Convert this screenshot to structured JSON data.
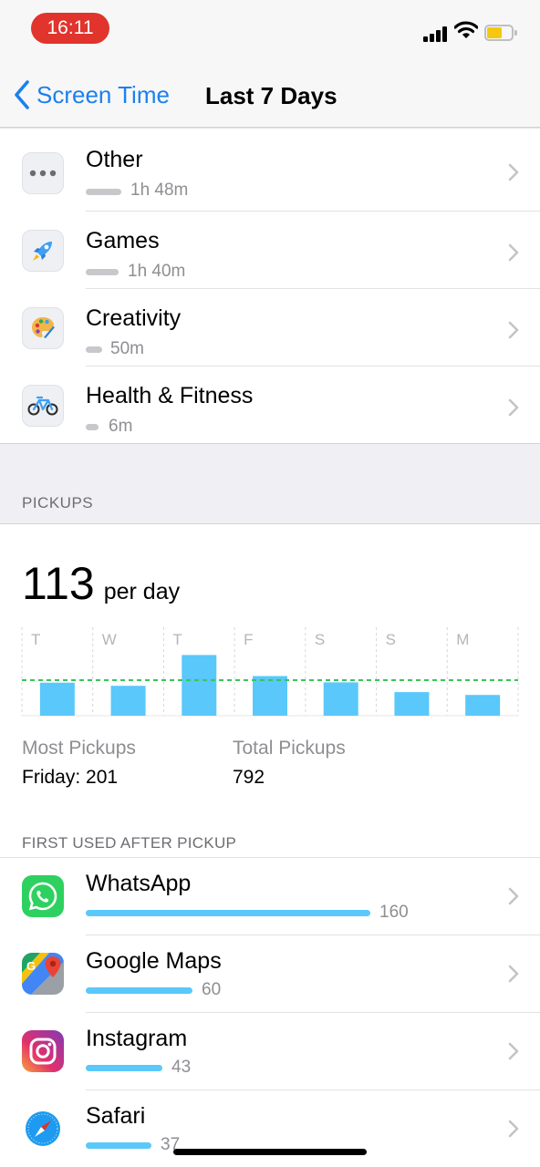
{
  "status_bar": {
    "time": "16:11",
    "time_pill_color": "#e0342c",
    "battery_color": "#f5c70f"
  },
  "nav": {
    "back_label": "Screen Time",
    "title": "Last 7 Days",
    "accent": "#1b80f0"
  },
  "categories": [
    {
      "name": "Other",
      "duration": "1h 48m",
      "icon": "ellipsis-icon",
      "usage_fraction": 1.0
    },
    {
      "name": "Games",
      "duration": "1h 40m",
      "icon": "rocket-icon",
      "usage_fraction": 0.93
    },
    {
      "name": "Creativity",
      "duration": "50m",
      "icon": "palette-icon",
      "usage_fraction": 0.46
    },
    {
      "name": "Health & Fitness",
      "duration": "6m",
      "icon": "bicycle-icon",
      "usage_fraction": 0.06
    }
  ],
  "pickups": {
    "section_header": "PICKUPS",
    "average": "113",
    "average_unit": "per day",
    "most_label": "Most Pickups",
    "most_value": "Friday: 201",
    "total_label": "Total Pickups",
    "total_value": "792",
    "first_used_header": "FIRST USED AFTER PICKUP"
  },
  "chart_data": {
    "type": "bar",
    "categories": [
      "T",
      "W",
      "T",
      "F",
      "S",
      "S",
      "M"
    ],
    "values": [
      105,
      95,
      193,
      126,
      106,
      75,
      66
    ],
    "average_line": 113,
    "ylim": [
      0,
      200
    ],
    "bar_color": "#5ac8fa",
    "average_line_color": "#34c759",
    "grid": "vertical dotted"
  },
  "first_used": [
    {
      "name": "WhatsApp",
      "count": "160",
      "value": 160,
      "icon": "whatsapp-icon"
    },
    {
      "name": "Google Maps",
      "count": "60",
      "value": 60,
      "icon": "google-maps-icon"
    },
    {
      "name": "Instagram",
      "count": "43",
      "value": 43,
      "icon": "instagram-icon"
    },
    {
      "name": "Safari",
      "count": "37",
      "value": 37,
      "icon": "safari-icon"
    }
  ]
}
